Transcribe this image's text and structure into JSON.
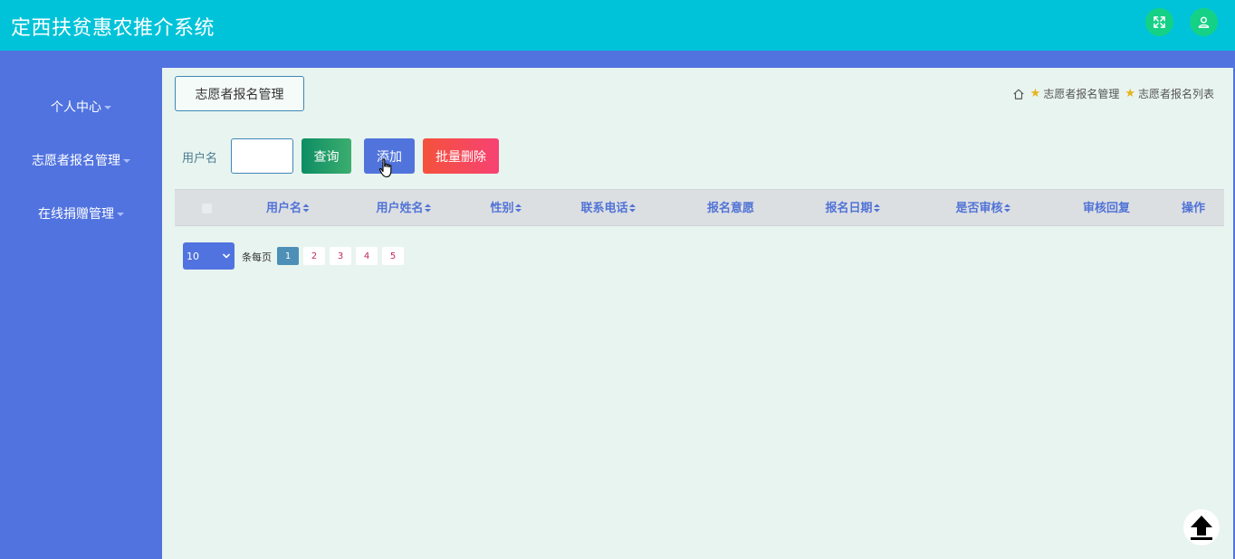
{
  "app": {
    "title": "定西扶贫惠农推介系统"
  },
  "header": {
    "icons": [
      "fullscreen-icon",
      "user-icon"
    ]
  },
  "sidebar": {
    "items": [
      {
        "label": "个人中心"
      },
      {
        "label": "志愿者报名管理"
      },
      {
        "label": "在线捐赠管理"
      }
    ]
  },
  "main": {
    "section_title": "志愿者报名管理",
    "breadcrumb": [
      "志愿者报名管理",
      "志愿者报名列表"
    ],
    "search": {
      "label": "用户名",
      "value": ""
    },
    "buttons": {
      "query": "查询",
      "add": "添加",
      "batch_delete": "批量删除"
    },
    "table": {
      "columns": [
        "用户名",
        "用户姓名",
        "性别",
        "联系电话",
        "报名意愿",
        "报名日期",
        "是否审核",
        "审核回复",
        "操作"
      ],
      "rows": []
    },
    "pagination": {
      "page_size": "10",
      "per_page_label": "条每页",
      "pages": [
        "1",
        "2",
        "3",
        "4",
        "5"
      ],
      "current": "1"
    }
  },
  "colors": {
    "topbar": "#00c3d9",
    "sidebar": "#5173e0",
    "background": "#e8f4ef",
    "accent_green": "#15d186",
    "delete": "#f74273"
  }
}
